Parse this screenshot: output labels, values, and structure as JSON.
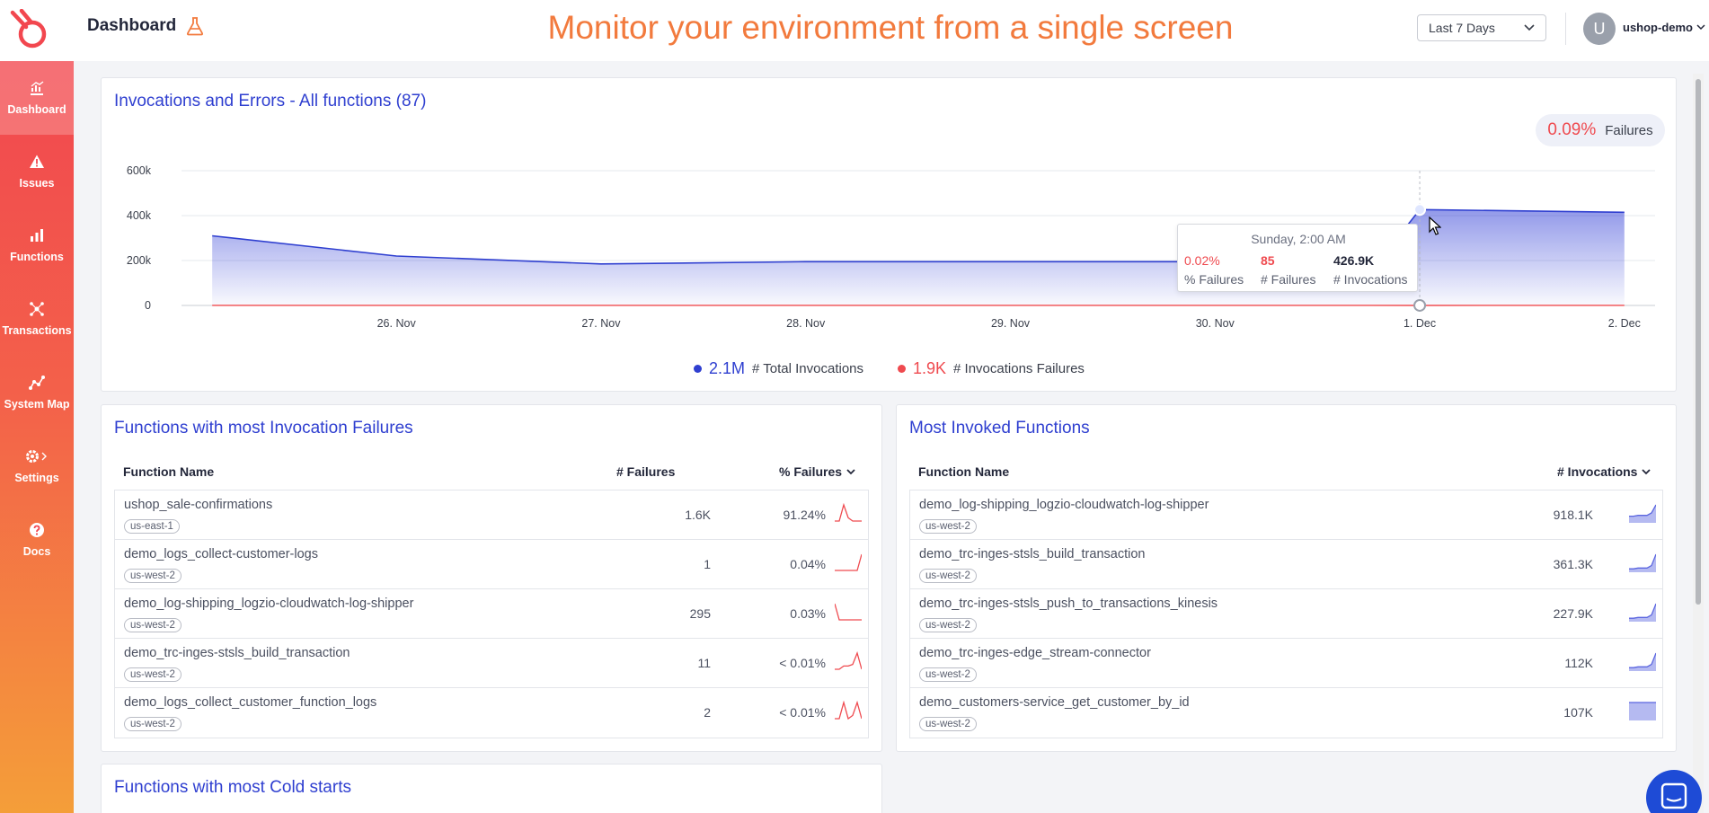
{
  "header": {
    "breadcrumb": "Dashboard",
    "headline": "Monitor your environment from a single screen",
    "time_range": "Last 7 Days",
    "avatar_letter": "U",
    "user": "ushop-demo"
  },
  "sidebar": {
    "items": [
      {
        "label": "Dashboard",
        "icon": "dashboard-icon",
        "active": true
      },
      {
        "label": "Issues",
        "icon": "warning-icon"
      },
      {
        "label": "Functions",
        "icon": "bar-chart-icon"
      },
      {
        "label": "Transactions",
        "icon": "transactions-icon"
      },
      {
        "label": "System Map",
        "icon": "system-map-icon"
      },
      {
        "label": "Settings",
        "icon": "gear-icon"
      },
      {
        "label": "Docs",
        "icon": "help-icon"
      }
    ]
  },
  "invocations_card": {
    "title": "Invocations and Errors - All functions (87)",
    "failures_pct": "0.09%",
    "failures_label": "Failures",
    "tooltip": {
      "title": "Sunday, 2:00 AM",
      "pct_failures": "0.02%",
      "failures": "85",
      "invocations": "426.9K",
      "pct_failures_label": "% Failures",
      "failures_label": "# Failures",
      "invocations_label": "# Invocations"
    },
    "legend": [
      {
        "value": "2.1M",
        "label": "# Total Invocations",
        "color": "#2f3fd0"
      },
      {
        "value": "1.9K",
        "label": "# Invocations Failures",
        "color": "#ef4a4f"
      }
    ]
  },
  "chart_data": {
    "type": "area",
    "x_tick_labels": [
      "26. Nov",
      "27. Nov",
      "28. Nov",
      "29. Nov",
      "30. Nov",
      "1. Dec",
      "2. Dec"
    ],
    "y_tick_labels": [
      "0",
      "200k",
      "400k",
      "600k"
    ],
    "ylim": [
      0,
      600000
    ],
    "grid": true,
    "series": [
      {
        "name": "# Total Invocations",
        "color": "#2f3fd0",
        "x": [
          -0.9,
          0.0,
          1.0,
          2.0,
          3.0,
          4.0,
          4.8,
          5.0,
          6.0
        ],
        "y": [
          310000,
          220000,
          185000,
          195000,
          195000,
          195000,
          195000,
          426900,
          415000
        ]
      },
      {
        "name": "# Invocations Failures",
        "color": "#ef4a4f",
        "x": [
          -0.9,
          0.0,
          1.0,
          2.0,
          3.0,
          4.0,
          5.0,
          6.0
        ],
        "y": [
          500,
          400,
          300,
          300,
          300,
          300,
          85,
          300
        ]
      }
    ]
  },
  "failures_card": {
    "title": "Functions with most Invocation Failures",
    "col_name": "Function Name",
    "col_failures": "# Failures",
    "col_pct": "% Failures",
    "rows": [
      {
        "name": "ushop_sale-confirmations",
        "region": "us-east-1",
        "failures": "1.6K",
        "pct": "91.24%",
        "spark": [
          0,
          0,
          1,
          0.2,
          0,
          0,
          0
        ]
      },
      {
        "name": "demo_logs_collect-customer-logs",
        "region": "us-west-2",
        "failures": "1",
        "pct": "0.04%",
        "spark": [
          0,
          0,
          0,
          0,
          0,
          0,
          1
        ]
      },
      {
        "name": "demo_log-shipping_logzio-cloudwatch-log-shipper",
        "region": "us-west-2",
        "failures": "295",
        "pct": "0.03%",
        "spark": [
          1,
          0,
          0,
          0,
          0,
          0,
          0
        ]
      },
      {
        "name": "demo_trc-inges-stsls_build_transaction",
        "region": "us-west-2",
        "failures": "11",
        "pct": "< 0.01%",
        "spark": [
          0,
          0,
          0.2,
          0.2,
          0.3,
          1,
          0
        ]
      },
      {
        "name": "demo_logs_collect_customer_function_logs",
        "region": "us-west-2",
        "failures": "2",
        "pct": "< 0.01%",
        "spark": [
          0,
          0,
          1,
          0,
          0.2,
          1,
          0
        ]
      }
    ]
  },
  "invoked_card": {
    "title": "Most Invoked Functions",
    "col_name": "Function Name",
    "col_invocations": "# Invocations",
    "rows": [
      {
        "name": "demo_log-shipping_logzio-cloudwatch-log-shipper",
        "region": "us-west-2",
        "invocations": "918.1K",
        "spark": [
          0.3,
          0.3,
          0.35,
          0.35,
          0.35,
          0.5,
          1
        ]
      },
      {
        "name": "demo_trc-inges-stsls_build_transaction",
        "region": "us-west-2",
        "invocations": "361.3K",
        "spark": [
          0.1,
          0.1,
          0.15,
          0.15,
          0.15,
          0.3,
          1
        ]
      },
      {
        "name": "demo_trc-inges-stsls_push_to_transactions_kinesis",
        "region": "us-west-2",
        "invocations": "227.9K",
        "spark": [
          0.1,
          0.1,
          0.15,
          0.15,
          0.15,
          0.3,
          1
        ]
      },
      {
        "name": "demo_trc-inges-edge_stream-connector",
        "region": "us-west-2",
        "invocations": "112K",
        "spark": [
          0.1,
          0.1,
          0.15,
          0.15,
          0.15,
          0.3,
          1
        ]
      },
      {
        "name": "demo_customers-service_get_customer_by_id",
        "region": "us-west-2",
        "invocations": "107K",
        "spark": [
          1,
          1,
          1,
          1,
          1,
          1,
          1
        ]
      }
    ]
  },
  "cold_starts_card": {
    "title": "Functions with most Cold starts"
  }
}
